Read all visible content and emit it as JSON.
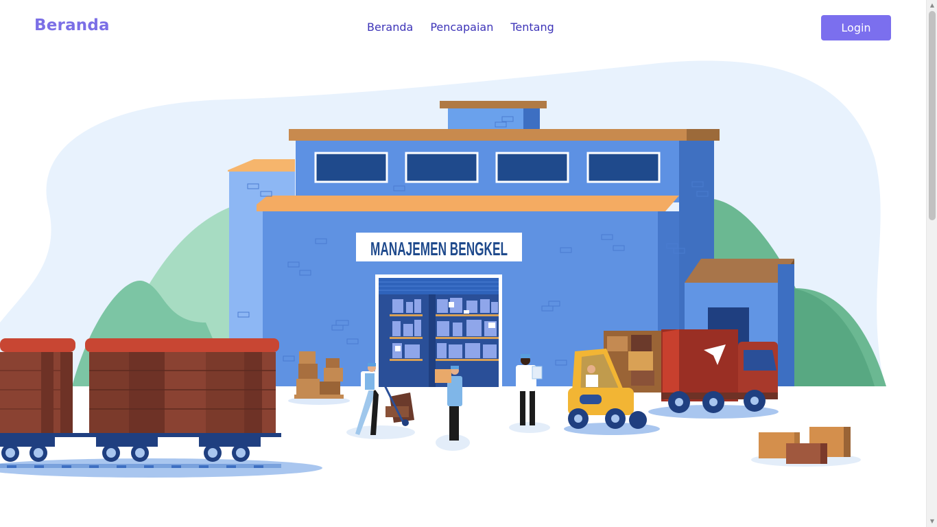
{
  "navbar": {
    "brand": "Beranda",
    "links": [
      "Beranda",
      "Pencapaian",
      "Tentang"
    ],
    "login_label": "Login"
  },
  "hero": {
    "building_sign": "MANAJEMEN BENGKEL"
  },
  "colors": {
    "accent": "#7b6fee",
    "nav_link": "#3d34b8",
    "building_blue": "#5b8fe0",
    "truck_red": "#a8392b"
  },
  "icons": {
    "scroll_up": "triangle-up",
    "scroll_down": "triangle-down"
  }
}
